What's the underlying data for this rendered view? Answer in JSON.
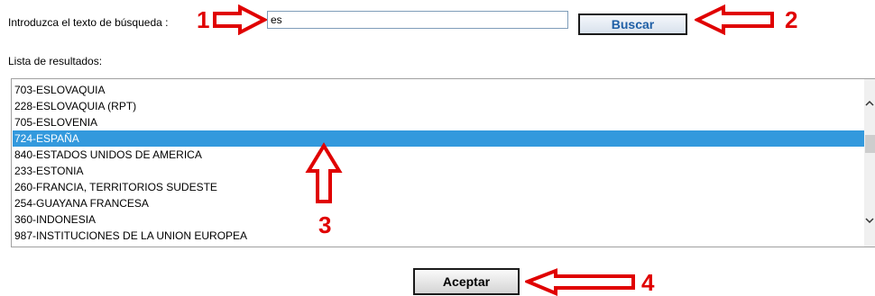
{
  "search": {
    "label": "Introduzca el texto de búsqueda :",
    "value": "es",
    "button_label": "Buscar"
  },
  "results": {
    "label": "Lista de resultados:",
    "items": [
      "703-ESLOVAQUIA",
      "228-ESLOVAQUIA (RPT)",
      "705-ESLOVENIA",
      "724-ESPAÑA",
      "840-ESTADOS UNIDOS DE AMERICA",
      "233-ESTONIA",
      "260-FRANCIA, TERRITORIOS SUDESTE",
      "254-GUAYANA FRANCESA",
      "360-INDONESIA",
      "987-INSTITUCIONES DE LA UNION EUROPEA"
    ],
    "selected_index": 3
  },
  "footer": {
    "accept_label": "Aceptar"
  },
  "annotations": {
    "num_1": "1",
    "num_2": "2",
    "num_3": "3",
    "num_4": "4",
    "color": "#e00000"
  },
  "colors": {
    "selection": "#3399dd",
    "button_text": "#1f5fa6"
  }
}
